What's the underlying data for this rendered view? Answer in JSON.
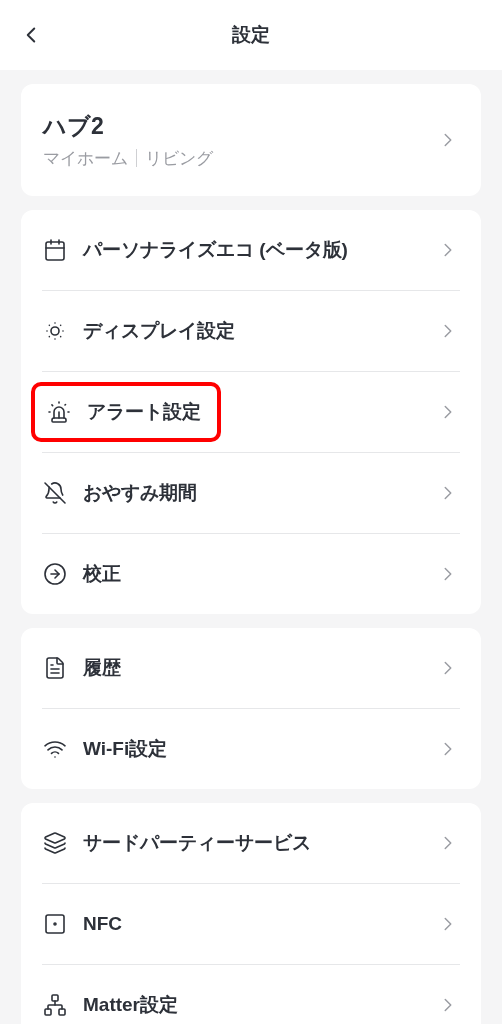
{
  "header": {
    "title": "設定"
  },
  "device": {
    "name": "ハブ2",
    "home": "マイホーム",
    "room": "リビング"
  },
  "groups": [
    {
      "items": [
        {
          "label": "パーソナライズエコ (ベータ版)",
          "highlighted": false
        },
        {
          "label": "ディスプレイ設定",
          "highlighted": false
        },
        {
          "label": "アラート設定",
          "highlighted": true
        },
        {
          "label": "おやすみ期間",
          "highlighted": false
        },
        {
          "label": "校正",
          "highlighted": false
        }
      ]
    },
    {
      "items": [
        {
          "label": "履歴",
          "highlighted": false
        },
        {
          "label": "Wi-Fi設定",
          "highlighted": false
        }
      ]
    },
    {
      "items": [
        {
          "label": "サードパーティーサービス",
          "highlighted": false
        },
        {
          "label": "NFC",
          "highlighted": false
        },
        {
          "label": "Matter設定",
          "highlighted": false
        }
      ]
    }
  ]
}
